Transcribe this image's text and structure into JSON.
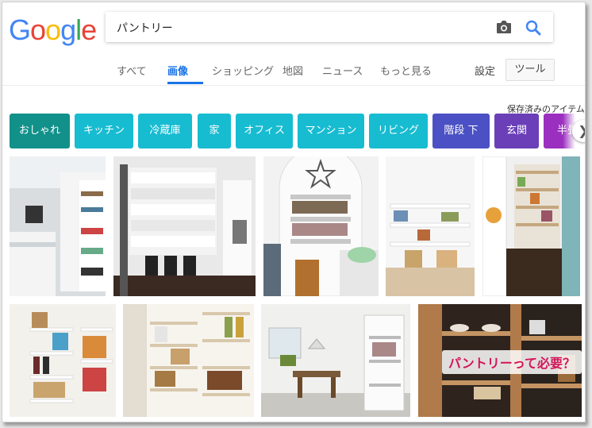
{
  "logo": {
    "text": "Google"
  },
  "search": {
    "value": "パントリー"
  },
  "icons": {
    "camera": "camera-icon",
    "search": "search-icon",
    "next": "chevron-right-icon"
  },
  "tabs": [
    {
      "label": "すべて",
      "active": false
    },
    {
      "label": "画像",
      "active": true
    },
    {
      "label": "ショッピング",
      "active": false
    },
    {
      "label": "地図",
      "active": false
    },
    {
      "label": "ニュース",
      "active": false
    },
    {
      "label": "もっと見る",
      "active": false
    }
  ],
  "settings_label": "設定",
  "tools_label": "ツール",
  "saved_label": "保存済みのアイテム",
  "chips": [
    {
      "label": "おしゃれ",
      "color": "#11918a"
    },
    {
      "label": "キッチン",
      "color": "#17bcd1"
    },
    {
      "label": "冷蔵庫",
      "color": "#17bcd1"
    },
    {
      "label": "家",
      "color": "#17bcd1"
    },
    {
      "label": "オフィス",
      "color": "#17bcd1"
    },
    {
      "label": "マンション",
      "color": "#17bcd1"
    },
    {
      "label": "リビング",
      "color": "#17bcd1"
    },
    {
      "label": "階段 下",
      "color": "#4b51c4"
    },
    {
      "label": "玄関",
      "color": "#6a3fb8"
    },
    {
      "label": "半畳",
      "color": "#9b2fbf"
    }
  ],
  "overlay_caption": "パントリーって必要？",
  "colors": {
    "accent": "#1a73e8"
  }
}
